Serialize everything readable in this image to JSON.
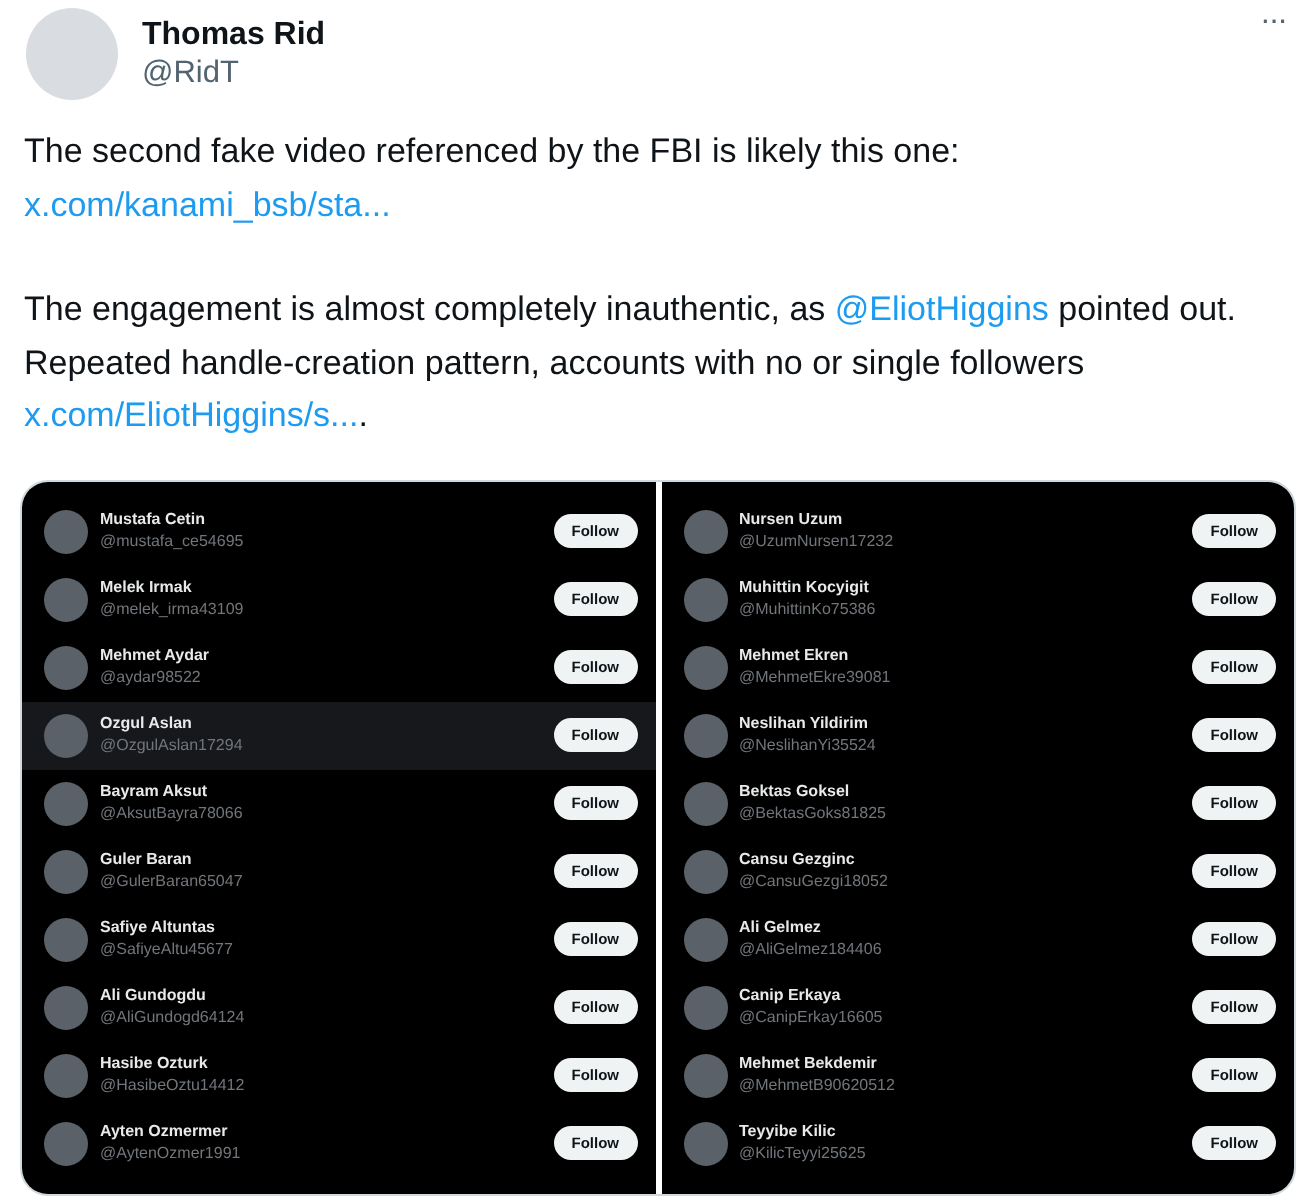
{
  "author": {
    "name": "Thomas Rid",
    "handle": "@RidT"
  },
  "more_button": "···",
  "paragraphs": [
    [
      {
        "kind": "text",
        "text": "The second fake video referenced by the FBI is likely this one: "
      },
      {
        "kind": "link",
        "text": "x.com/kanami_bsb/sta..."
      }
    ],
    [
      {
        "kind": "text",
        "text": "The engagement is almost completely inauthentic, as "
      },
      {
        "kind": "link",
        "text": "@EliotHiggins"
      },
      {
        "kind": "text",
        "text": " pointed out. Repeated handle-creation pattern, accounts with no or single followers  "
      },
      {
        "kind": "link",
        "text": "x.com/EliotHiggins/s..."
      },
      {
        "kind": "text",
        "text": "."
      }
    ]
  ],
  "image_panels": [
    {
      "rows": [
        {
          "name": "Mustafa Cetin",
          "handle": "@mustafa_ce54695",
          "button": "Follow",
          "hovered": false
        },
        {
          "name": "Melek Irmak",
          "handle": "@melek_irma43109",
          "button": "Follow",
          "hovered": false
        },
        {
          "name": "Mehmet Aydar",
          "handle": "@aydar98522",
          "button": "Follow",
          "hovered": false
        },
        {
          "name": "Ozgul Aslan",
          "handle": "@OzgulAslan17294",
          "button": "Follow",
          "hovered": true
        },
        {
          "name": "Bayram Aksut",
          "handle": "@AksutBayra78066",
          "button": "Follow",
          "hovered": false
        },
        {
          "name": "Guler Baran",
          "handle": "@GulerBaran65047",
          "button": "Follow",
          "hovered": false
        },
        {
          "name": "Safiye Altuntas",
          "handle": "@SafiyeAltu45677",
          "button": "Follow",
          "hovered": false
        },
        {
          "name": "Ali Gundogdu",
          "handle": "@AliGundogd64124",
          "button": "Follow",
          "hovered": false
        },
        {
          "name": "Hasibe Ozturk",
          "handle": "@HasibeOztu14412",
          "button": "Follow",
          "hovered": false
        },
        {
          "name": "Ayten Ozmermer",
          "handle": "@AytenOzmer1991",
          "button": "Follow",
          "hovered": false
        }
      ]
    },
    {
      "rows": [
        {
          "name": "Nursen Uzum",
          "handle": "@UzumNursen17232",
          "button": "Follow",
          "hovered": false
        },
        {
          "name": "Muhittin Kocyigit",
          "handle": "@MuhittinKo75386",
          "button": "Follow",
          "hovered": false
        },
        {
          "name": "Mehmet Ekren",
          "handle": "@MehmetEkre39081",
          "button": "Follow",
          "hovered": false
        },
        {
          "name": "Neslihan Yildirim",
          "handle": "@NeslihanYi35524",
          "button": "Follow",
          "hovered": false
        },
        {
          "name": "Bektas Goksel",
          "handle": "@BektasGoks81825",
          "button": "Follow",
          "hovered": false
        },
        {
          "name": "Cansu Gezginc",
          "handle": "@CansuGezgi18052",
          "button": "Follow",
          "hovered": false
        },
        {
          "name": "Ali Gelmez",
          "handle": "@AliGelmez184406",
          "button": "Follow",
          "hovered": false
        },
        {
          "name": "Canip Erkaya",
          "handle": "@CanipErkay16605",
          "button": "Follow",
          "hovered": false
        },
        {
          "name": "Mehmet Bekdemir",
          "handle": "@MehmetB90620512",
          "button": "Follow",
          "hovered": false
        },
        {
          "name": "Teyyibe Kilic",
          "handle": "@KilicTeyyi25625",
          "button": "Follow",
          "hovered": false
        }
      ]
    }
  ]
}
